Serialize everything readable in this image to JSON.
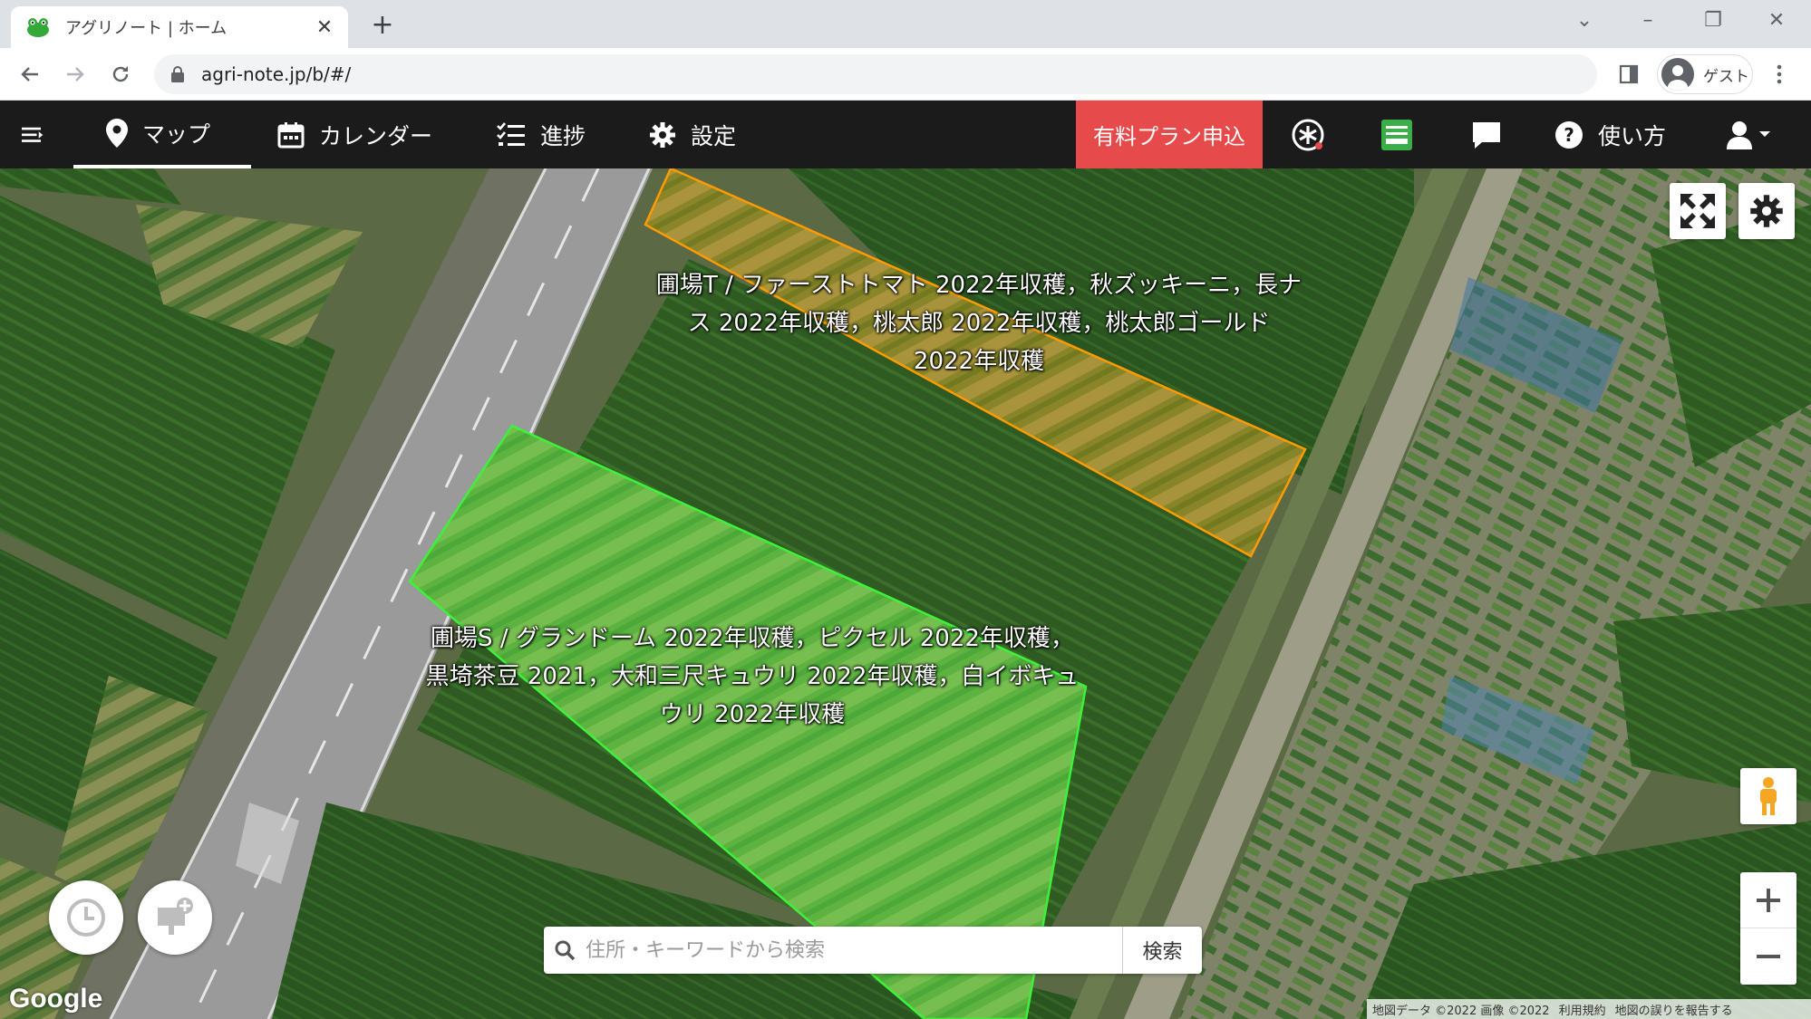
{
  "browser": {
    "tab_title": "アグリノート | ホーム",
    "url": "agri-note.jp/b/#/",
    "profile_label": "ゲスト"
  },
  "header": {
    "nav": [
      {
        "label": "マップ",
        "icon": "map-pin-icon",
        "active": true
      },
      {
        "label": "カレンダー",
        "icon": "calendar-icon",
        "active": false
      },
      {
        "label": "進捗",
        "icon": "checklist-icon",
        "active": false
      },
      {
        "label": "設定",
        "icon": "gear-icon",
        "active": false
      }
    ],
    "paid_plan_label": "有料プラン申込",
    "help_label": "使い方"
  },
  "map": {
    "fields": [
      {
        "name": "圃場T",
        "label_lines": [
          "圃場T / ファーストトマト 2022年収穫，秋ズッキーニ，長ナ",
          "ス 2022年収穫，桃太郎 2022年収穫，桃太郎ゴールド",
          "2022年収穫"
        ],
        "border_color": "#ff9a00"
      },
      {
        "name": "圃場S",
        "label_lines": [
          "圃場S / グランドーム 2022年収穫，ピクセル 2022年収穫，",
          "黒埼茶豆 2021，大和三尺キュウリ 2022年収穫，白イボキュ",
          "ウリ 2022年収穫"
        ],
        "border_color": "#3df23a"
      }
    ],
    "search": {
      "placeholder": "住所・キーワードから検索",
      "button_label": "検索"
    },
    "google_logo": "Google",
    "attribution": {
      "map_data": "地図データ ©2022 画像 ©2022",
      "terms": "利用規約",
      "report": "地図の誤りを報告する"
    }
  }
}
